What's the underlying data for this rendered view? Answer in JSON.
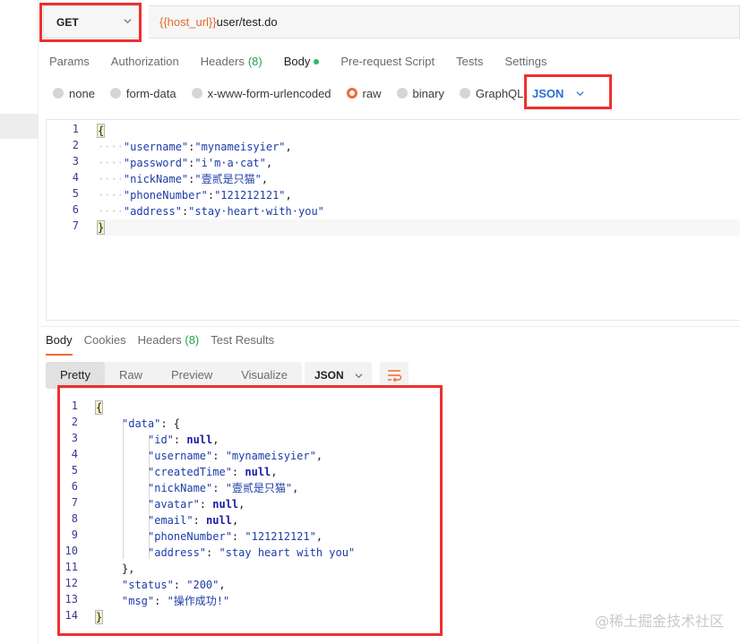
{
  "request": {
    "method": "GET",
    "url_var": "{{host_url}}",
    "url_path": "user/test.do"
  },
  "request_tabs": [
    {
      "label": "Params"
    },
    {
      "label": "Authorization"
    },
    {
      "label": "Headers",
      "count": "(8)"
    },
    {
      "label": "Body",
      "active": true
    },
    {
      "label": "Pre-request Script"
    },
    {
      "label": "Tests"
    },
    {
      "label": "Settings"
    }
  ],
  "body_types": [
    {
      "label": "none"
    },
    {
      "label": "form-data"
    },
    {
      "label": "x-www-form-urlencoded"
    },
    {
      "label": "raw",
      "checked": true
    },
    {
      "label": "binary"
    },
    {
      "label": "GraphQL"
    }
  ],
  "raw_format": "JSON",
  "request_body_lines": [
    {
      "n": "1",
      "parts": [
        [
          "bracket",
          "{"
        ]
      ]
    },
    {
      "n": "2",
      "parts": [
        [
          "ws",
          "····"
        ],
        [
          "key",
          "\"username\""
        ],
        [
          "pun",
          ":"
        ],
        [
          "str",
          "\"mynameisyier\""
        ],
        [
          "pun",
          ","
        ]
      ]
    },
    {
      "n": "3",
      "parts": [
        [
          "ws",
          "····"
        ],
        [
          "key",
          "\"password\""
        ],
        [
          "pun",
          ":"
        ],
        [
          "str",
          "\"i'm·a·cat\""
        ],
        [
          "pun",
          ","
        ]
      ]
    },
    {
      "n": "4",
      "parts": [
        [
          "ws",
          "····"
        ],
        [
          "key",
          "\"nickName\""
        ],
        [
          "pun",
          ":"
        ],
        [
          "str",
          "\"壹贰是只猫\""
        ],
        [
          "pun",
          ","
        ]
      ]
    },
    {
      "n": "5",
      "parts": [
        [
          "ws",
          "····"
        ],
        [
          "key",
          "\"phoneNumber\""
        ],
        [
          "pun",
          ":"
        ],
        [
          "str",
          "\"121212121\""
        ],
        [
          "pun",
          ","
        ]
      ]
    },
    {
      "n": "6",
      "parts": [
        [
          "ws",
          "····"
        ],
        [
          "key",
          "\"address\""
        ],
        [
          "pun",
          ":"
        ],
        [
          "str",
          "\"stay·heart·with·you\""
        ]
      ]
    },
    {
      "n": "7",
      "parts": [
        [
          "bracket",
          "}"
        ]
      ]
    }
  ],
  "response_tabs": [
    {
      "label": "Body",
      "active": true
    },
    {
      "label": "Cookies"
    },
    {
      "label": "Headers",
      "count": "(8)"
    },
    {
      "label": "Test Results"
    }
  ],
  "view_modes": [
    {
      "label": "Pretty",
      "active": true
    },
    {
      "label": "Raw"
    },
    {
      "label": "Preview"
    },
    {
      "label": "Visualize"
    }
  ],
  "response_format": "JSON",
  "response_lines": [
    {
      "n": "1",
      "parts": [
        [
          "bracket",
          "{"
        ]
      ]
    },
    {
      "n": "2",
      "indent": 1,
      "parts": [
        [
          "key",
          "\"data\""
        ],
        [
          "pun",
          ": {"
        ]
      ]
    },
    {
      "n": "3",
      "indent": 2,
      "parts": [
        [
          "key",
          "\"id\""
        ],
        [
          "pun",
          ": "
        ],
        [
          "nul",
          "null"
        ],
        [
          "pun",
          ","
        ]
      ]
    },
    {
      "n": "4",
      "indent": 2,
      "parts": [
        [
          "key",
          "\"username\""
        ],
        [
          "pun",
          ": "
        ],
        [
          "str",
          "\"mynameisyier\""
        ],
        [
          "pun",
          ","
        ]
      ]
    },
    {
      "n": "5",
      "indent": 2,
      "parts": [
        [
          "key",
          "\"createdTime\""
        ],
        [
          "pun",
          ": "
        ],
        [
          "nul",
          "null"
        ],
        [
          "pun",
          ","
        ]
      ]
    },
    {
      "n": "6",
      "indent": 2,
      "parts": [
        [
          "key",
          "\"nickName\""
        ],
        [
          "pun",
          ": "
        ],
        [
          "str",
          "\"壹贰是只猫\""
        ],
        [
          "pun",
          ","
        ]
      ]
    },
    {
      "n": "7",
      "indent": 2,
      "parts": [
        [
          "key",
          "\"avatar\""
        ],
        [
          "pun",
          ": "
        ],
        [
          "nul",
          "null"
        ],
        [
          "pun",
          ","
        ]
      ]
    },
    {
      "n": "8",
      "indent": 2,
      "parts": [
        [
          "key",
          "\"email\""
        ],
        [
          "pun",
          ": "
        ],
        [
          "nul",
          "null"
        ],
        [
          "pun",
          ","
        ]
      ]
    },
    {
      "n": "9",
      "indent": 2,
      "parts": [
        [
          "key",
          "\"phoneNumber\""
        ],
        [
          "pun",
          ": "
        ],
        [
          "str",
          "\"121212121\""
        ],
        [
          "pun",
          ","
        ]
      ]
    },
    {
      "n": "10",
      "indent": 2,
      "parts": [
        [
          "key",
          "\"address\""
        ],
        [
          "pun",
          ": "
        ],
        [
          "str",
          "\"stay heart with you\""
        ]
      ]
    },
    {
      "n": "11",
      "indent": 1,
      "parts": [
        [
          "pun",
          "},"
        ]
      ]
    },
    {
      "n": "12",
      "indent": 1,
      "parts": [
        [
          "key",
          "\"status\""
        ],
        [
          "pun",
          ": "
        ],
        [
          "str",
          "\"200\""
        ],
        [
          "pun",
          ","
        ]
      ]
    },
    {
      "n": "13",
      "indent": 1,
      "parts": [
        [
          "key",
          "\"msg\""
        ],
        [
          "pun",
          ": "
        ],
        [
          "str",
          "\"操作成功!\""
        ]
      ]
    },
    {
      "n": "14",
      "parts": [
        [
          "bracket",
          "}"
        ]
      ]
    }
  ],
  "watermark": "@稀土掘金技术社区",
  "colors": {
    "accent": "#f06a35",
    "highlight": "#ef2f2f",
    "link_blue": "#2a6fd6"
  }
}
